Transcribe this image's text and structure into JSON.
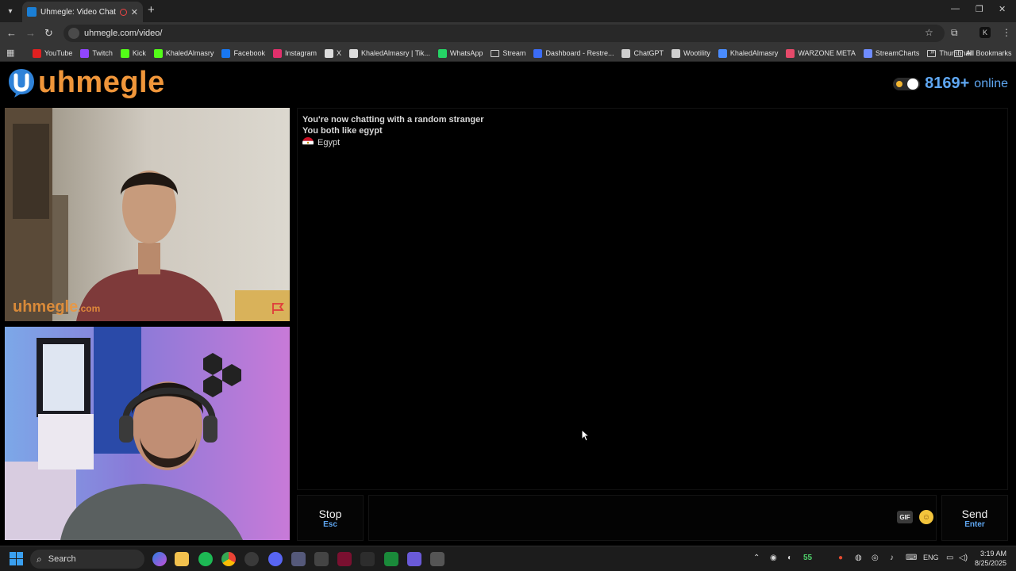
{
  "browser": {
    "tab_title": "Uhmegle: Video Chat | Omegle",
    "url": "uhmegle.com/video/",
    "bookmarks": [
      {
        "label": "YouTube",
        "icon": "youtube-icon",
        "color": "#e02020"
      },
      {
        "label": "Twitch",
        "icon": "twitch-icon",
        "color": "#9146ff"
      },
      {
        "label": "Kick",
        "icon": "kick-icon",
        "color": "#53fc18"
      },
      {
        "label": "KhaledAlmasry",
        "icon": "kick-icon",
        "color": "#53fc18"
      },
      {
        "label": "Facebook",
        "icon": "facebook-icon",
        "color": "#1877f2"
      },
      {
        "label": "Instagram",
        "icon": "instagram-icon",
        "color": "#e1306c"
      },
      {
        "label": "X",
        "icon": "x-icon",
        "color": "#dddddd"
      },
      {
        "label": "KhaledAlmasry | Tik...",
        "icon": "tiktok-icon",
        "color": "#dddddd"
      },
      {
        "label": "WhatsApp",
        "icon": "whatsapp-icon",
        "color": "#25d366"
      },
      {
        "label": "Stream",
        "icon": "folder-icon",
        "color": "#cfcfcf"
      },
      {
        "label": "Dashboard - Restre...",
        "icon": "restream-icon",
        "color": "#3b6cf6"
      },
      {
        "label": "ChatGPT",
        "icon": "chatgpt-icon",
        "color": "#cfcfcf"
      },
      {
        "label": "Wootility",
        "icon": "wootility-icon",
        "color": "#cfcfcf"
      },
      {
        "label": "KhaledAlmasry",
        "icon": "meta-icon",
        "color": "#4a8cff"
      },
      {
        "label": "WARZONE META",
        "icon": "warzone-icon",
        "color": "#e64a6a"
      },
      {
        "label": "StreamCharts",
        "icon": "streamcharts-icon",
        "color": "#6f8cff"
      },
      {
        "label": "Thumbnail",
        "icon": "folder-icon",
        "color": "#cfcfcf"
      }
    ],
    "all_bookmarks_label": "All Bookmarks"
  },
  "site": {
    "logo_text": "uhmegle",
    "online_count": "8169+",
    "online_label": "online",
    "watermark_main": "uhmegle",
    "watermark_suffix": ".com"
  },
  "chat": {
    "line1": "You're now chatting with a random stranger",
    "line2": "You both like egypt",
    "country": "Egypt"
  },
  "controls": {
    "stop_label": "Stop",
    "stop_key": "Esc",
    "gif_label": "GIF",
    "send_label": "Send",
    "send_key": "Enter"
  },
  "taskbar": {
    "search_label": "Search",
    "badge_count": "55",
    "language": "ENG",
    "time": "3:19 AM",
    "date": "8/25/2025"
  },
  "colors": {
    "brand_orange": "#f0963a",
    "accent_blue": "#5fa7f2"
  }
}
